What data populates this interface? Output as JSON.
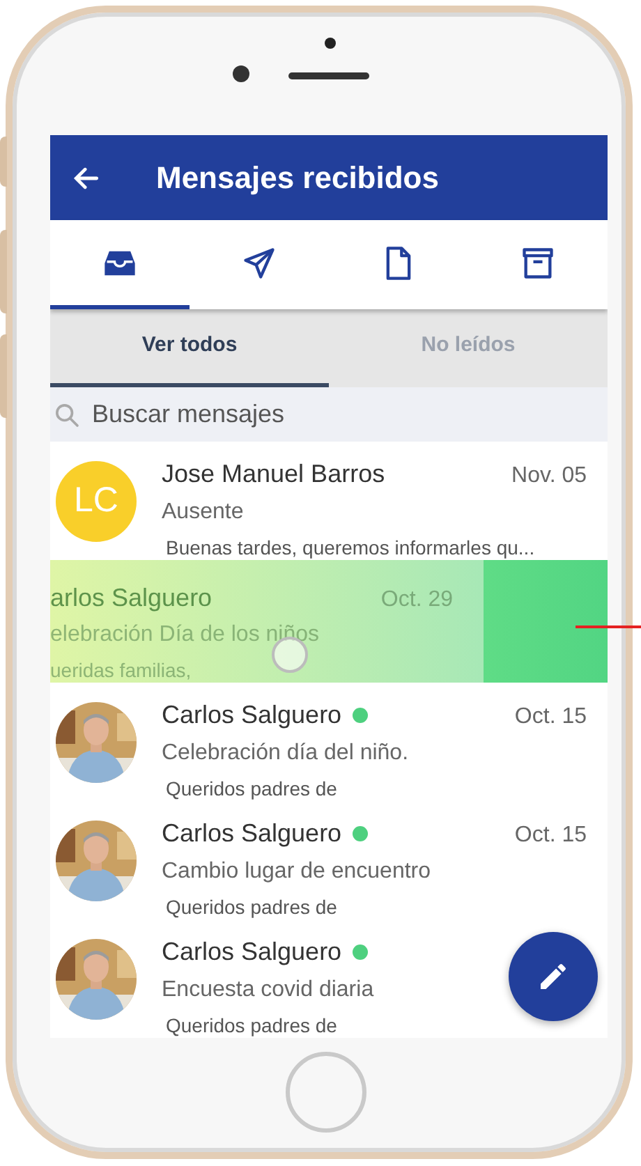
{
  "header": {
    "title": "Mensajes recibidos"
  },
  "folder_tabs": [
    {
      "kind": "inbox",
      "selected": true
    },
    {
      "kind": "sent",
      "selected": false
    },
    {
      "kind": "draft",
      "selected": false
    },
    {
      "kind": "archive",
      "selected": false
    }
  ],
  "filter_tabs": [
    {
      "label": "Ver todos",
      "selected": true
    },
    {
      "label": "No leídos",
      "selected": false
    }
  ],
  "search": {
    "placeholder": "Buscar mensajes"
  },
  "messages": [
    {
      "kind": "initials",
      "initials": "LC",
      "color": "#f9cf2a",
      "sender": "Jose Manuel Barros",
      "online": false,
      "date": "Nov. 05",
      "subject": "Ausente",
      "preview": "Buenas tardes, queremos informarles qu..."
    },
    {
      "kind": "swiped",
      "sender": "arlos Salguero",
      "date": "Oct. 29",
      "subject": "elebración Día de los niños",
      "preview": "ueridas familias,"
    },
    {
      "sender": "Carlos Salguero",
      "online": true,
      "date": "Oct. 15",
      "subject": "Celebración día del niño.",
      "preview": "Queridos padres de"
    },
    {
      "sender": "Carlos Salguero",
      "online": true,
      "date": "Oct. 15",
      "subject": "Cambio lugar de encuentro",
      "preview": "Queridos padres de"
    },
    {
      "sender": "Carlos Salguero",
      "online": true,
      "subject": "Encuesta covid diaria",
      "preview": "Queridos padres de"
    }
  ],
  "fab": {
    "kind": "compose"
  }
}
